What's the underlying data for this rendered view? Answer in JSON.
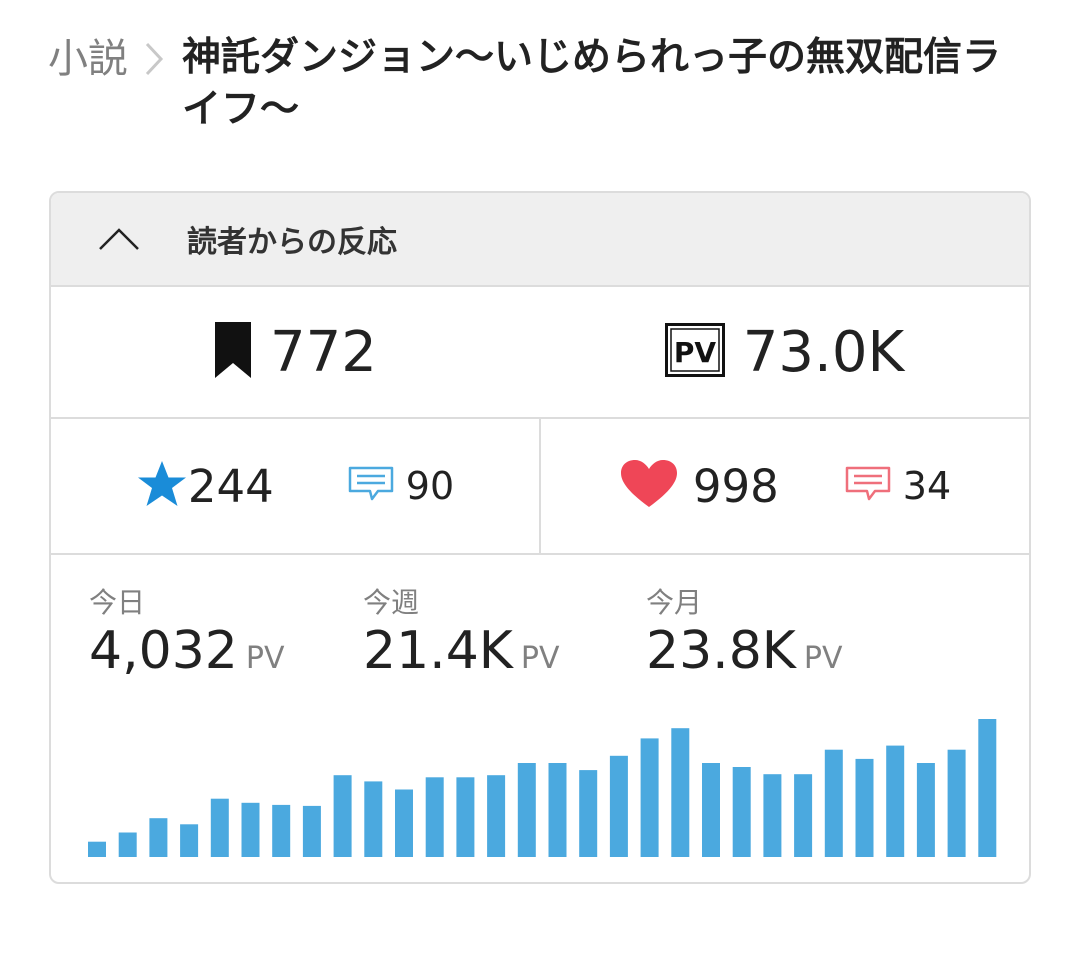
{
  "breadcrumb": {
    "parent": "小説",
    "title": "神託ダンジョン〜いじめられっ子の無双配信ライフ〜"
  },
  "panel": {
    "title": "読者からの反応",
    "toggle_icon": "chevron-up-icon"
  },
  "summary": {
    "bookmarks": "772",
    "pv_badge": "PV",
    "pv_total": "73.0K"
  },
  "reactions": {
    "stars": "244",
    "star_comments": "90",
    "hearts": "998",
    "heart_comments": "34",
    "colors": {
      "star": "#1a8cd8",
      "heart": "#ef4657",
      "chart": "#4ba9df"
    }
  },
  "pv_stats": [
    {
      "label": "今日",
      "value": "4,032",
      "unit": "PV"
    },
    {
      "label": "今週",
      "value": "21.4K",
      "unit": "PV"
    },
    {
      "label": "今月",
      "value": "23.8K",
      "unit": "PV"
    }
  ],
  "chart_data": {
    "type": "bar",
    "values": [
      15,
      24,
      38,
      32,
      57,
      53,
      51,
      50,
      80,
      74,
      66,
      78,
      78,
      80,
      92,
      92,
      85,
      99,
      116,
      126,
      92,
      88,
      81,
      81,
      105,
      96,
      109,
      92,
      105,
      135
    ]
  }
}
